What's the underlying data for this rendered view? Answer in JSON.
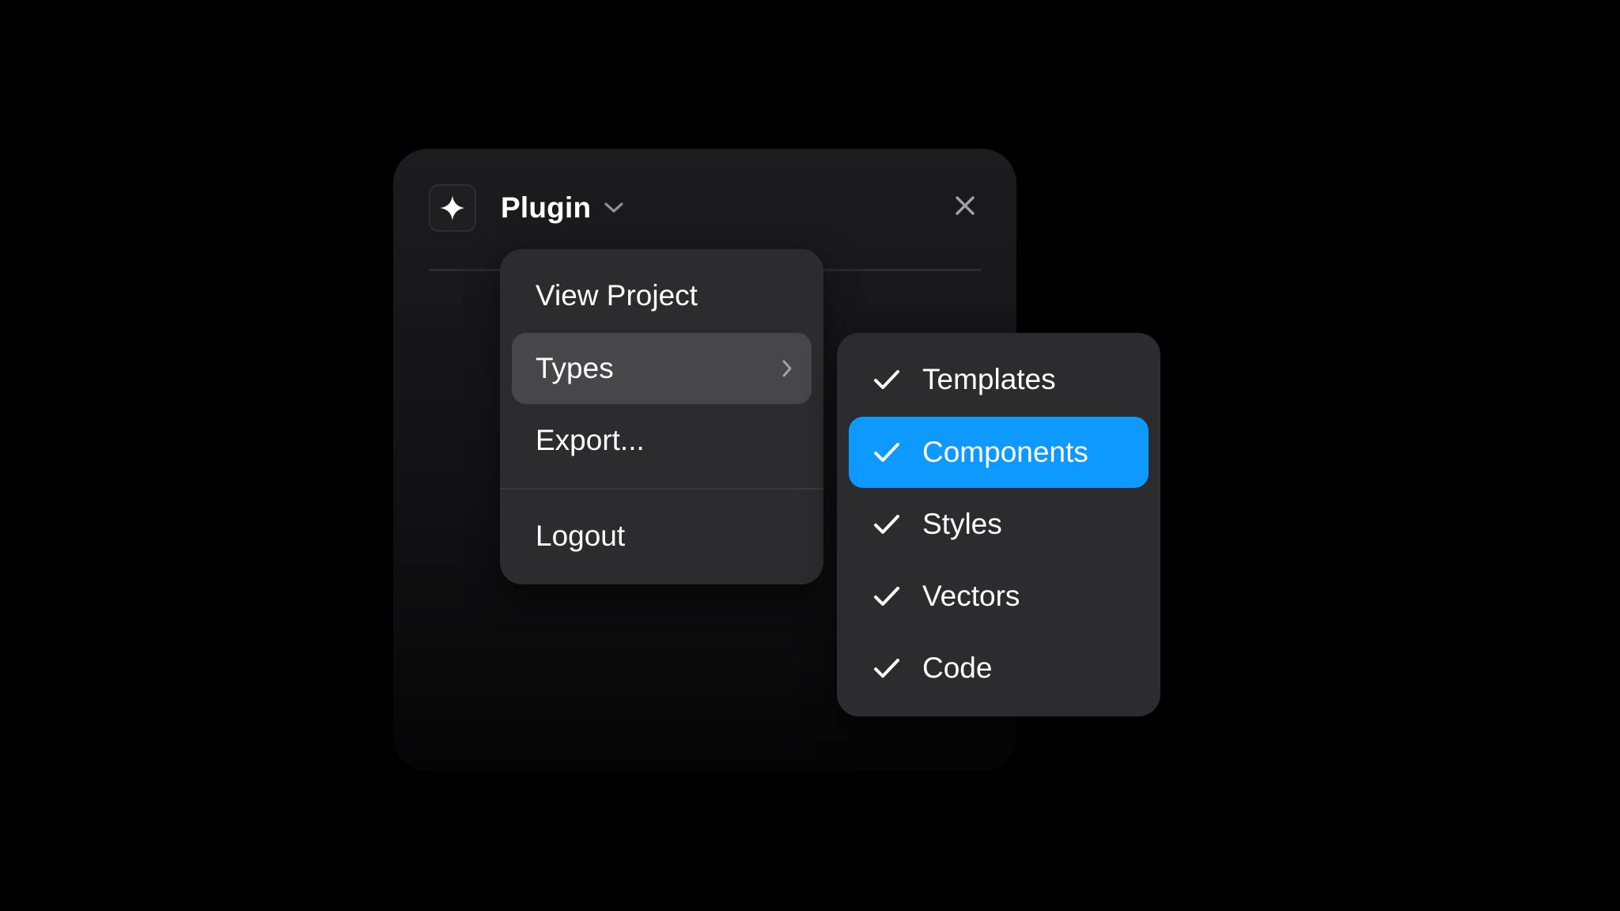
{
  "plugin": {
    "title": "Plugin",
    "icon": "sparkle-icon",
    "close_icon": "close-icon",
    "dropdown_icon": "chevron-down-icon"
  },
  "menu": {
    "items": [
      {
        "label": "View Project",
        "highlighted": false
      },
      {
        "label": "Types",
        "highlighted": true,
        "has_submenu": true
      },
      {
        "label": "Export...",
        "highlighted": false
      },
      {
        "label": "Logout",
        "highlighted": false
      }
    ]
  },
  "submenu": {
    "items": [
      {
        "label": "Templates",
        "checked": true,
        "active": false
      },
      {
        "label": "Components",
        "checked": true,
        "active": true
      },
      {
        "label": "Styles",
        "checked": true,
        "active": false
      },
      {
        "label": "Vectors",
        "checked": true,
        "active": false
      },
      {
        "label": "Code",
        "checked": true,
        "active": false
      }
    ]
  },
  "colors": {
    "background": "#000000",
    "menu_background": "#2c2c2f",
    "highlight": "#47474b",
    "accent": "#0d99ff",
    "text": "#ffffff"
  }
}
